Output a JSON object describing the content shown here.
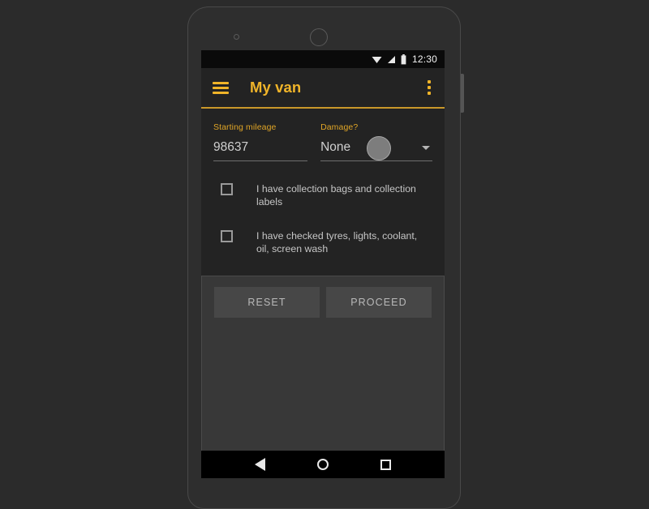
{
  "status_bar": {
    "wifi_icon": "wifi-icon",
    "signal_icon": "signal-icon",
    "battery_icon": "battery-icon",
    "clock": "12:30"
  },
  "app_bar": {
    "menu_icon": "hamburger-menu-icon",
    "title": "My van",
    "overflow_icon": "overflow-menu-icon",
    "accent_color": "#f0b429"
  },
  "form": {
    "mileage": {
      "label": "Starting mileage",
      "value": "98637"
    },
    "damage": {
      "label": "Damage?",
      "value": "None",
      "caret_icon": "chevron-down-icon"
    },
    "checkboxes": [
      {
        "label": "I have collection bags and collection labels",
        "checked": false
      },
      {
        "label": "I have checked tyres, lights, coolant, oil, screen wash",
        "checked": false
      }
    ]
  },
  "actions": {
    "reset_label": "RESET",
    "proceed_label": "PROCEED"
  },
  "nav_bar": {
    "back_icon": "back-triangle-icon",
    "home_icon": "home-circle-icon",
    "recents_icon": "recents-square-icon"
  }
}
